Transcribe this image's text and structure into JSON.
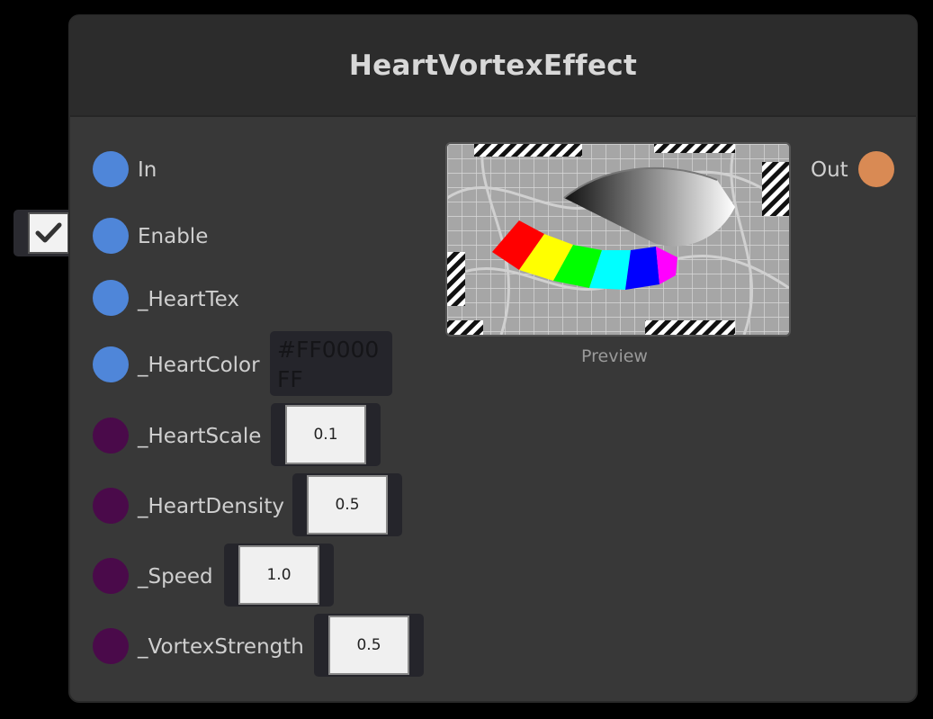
{
  "node": {
    "title": "HeartVortexEffect",
    "preview_label": "Preview",
    "output": {
      "label": "Out",
      "color": "#d98a54"
    },
    "enable_checked": true,
    "inputs": [
      {
        "label": "In",
        "color": "#4f86d9"
      },
      {
        "label": "Enable",
        "color": "#4f86d9"
      },
      {
        "label": "_HeartTex",
        "color": "#4f86d9"
      },
      {
        "label": "_HeartColor",
        "color": "#4f86d9",
        "value": "#FF0000FF"
      },
      {
        "label": "_HeartScale",
        "color": "#4a0a4a",
        "value": "0.1"
      },
      {
        "label": "_HeartDensity",
        "color": "#4a0a4a",
        "value": "0.5"
      },
      {
        "label": "_Speed",
        "color": "#4a0a4a",
        "value": "1.0"
      },
      {
        "label": "_VortexStrength",
        "color": "#4a0a4a",
        "value": "0.5"
      }
    ]
  }
}
